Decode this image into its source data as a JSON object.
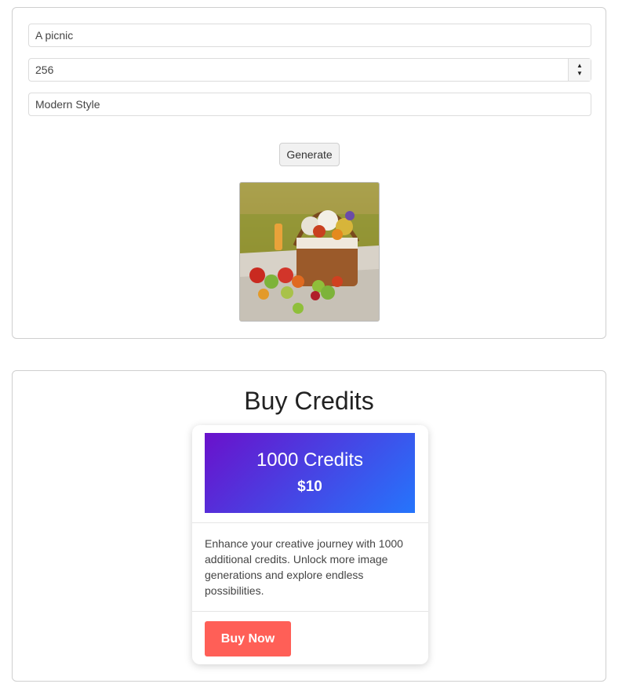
{
  "generator": {
    "prompt_value": "A picnic",
    "size_value": "256",
    "style_value": "Modern Style",
    "generate_label": "Generate",
    "image_subject": "picnic basket with flowers and fruit on a blanket"
  },
  "buy_credits": {
    "title": "Buy Credits",
    "card": {
      "credits": "1000 Credits",
      "price": "$10",
      "description": "Enhance your creative journey with 1000 additional credits. Unlock more image generations and explore endless possibilities.",
      "button_label": "Buy Now"
    }
  },
  "colors": {
    "gradient_start": "#6a11cb",
    "gradient_end": "#2575fc",
    "buy_button": "#ff5f57"
  }
}
